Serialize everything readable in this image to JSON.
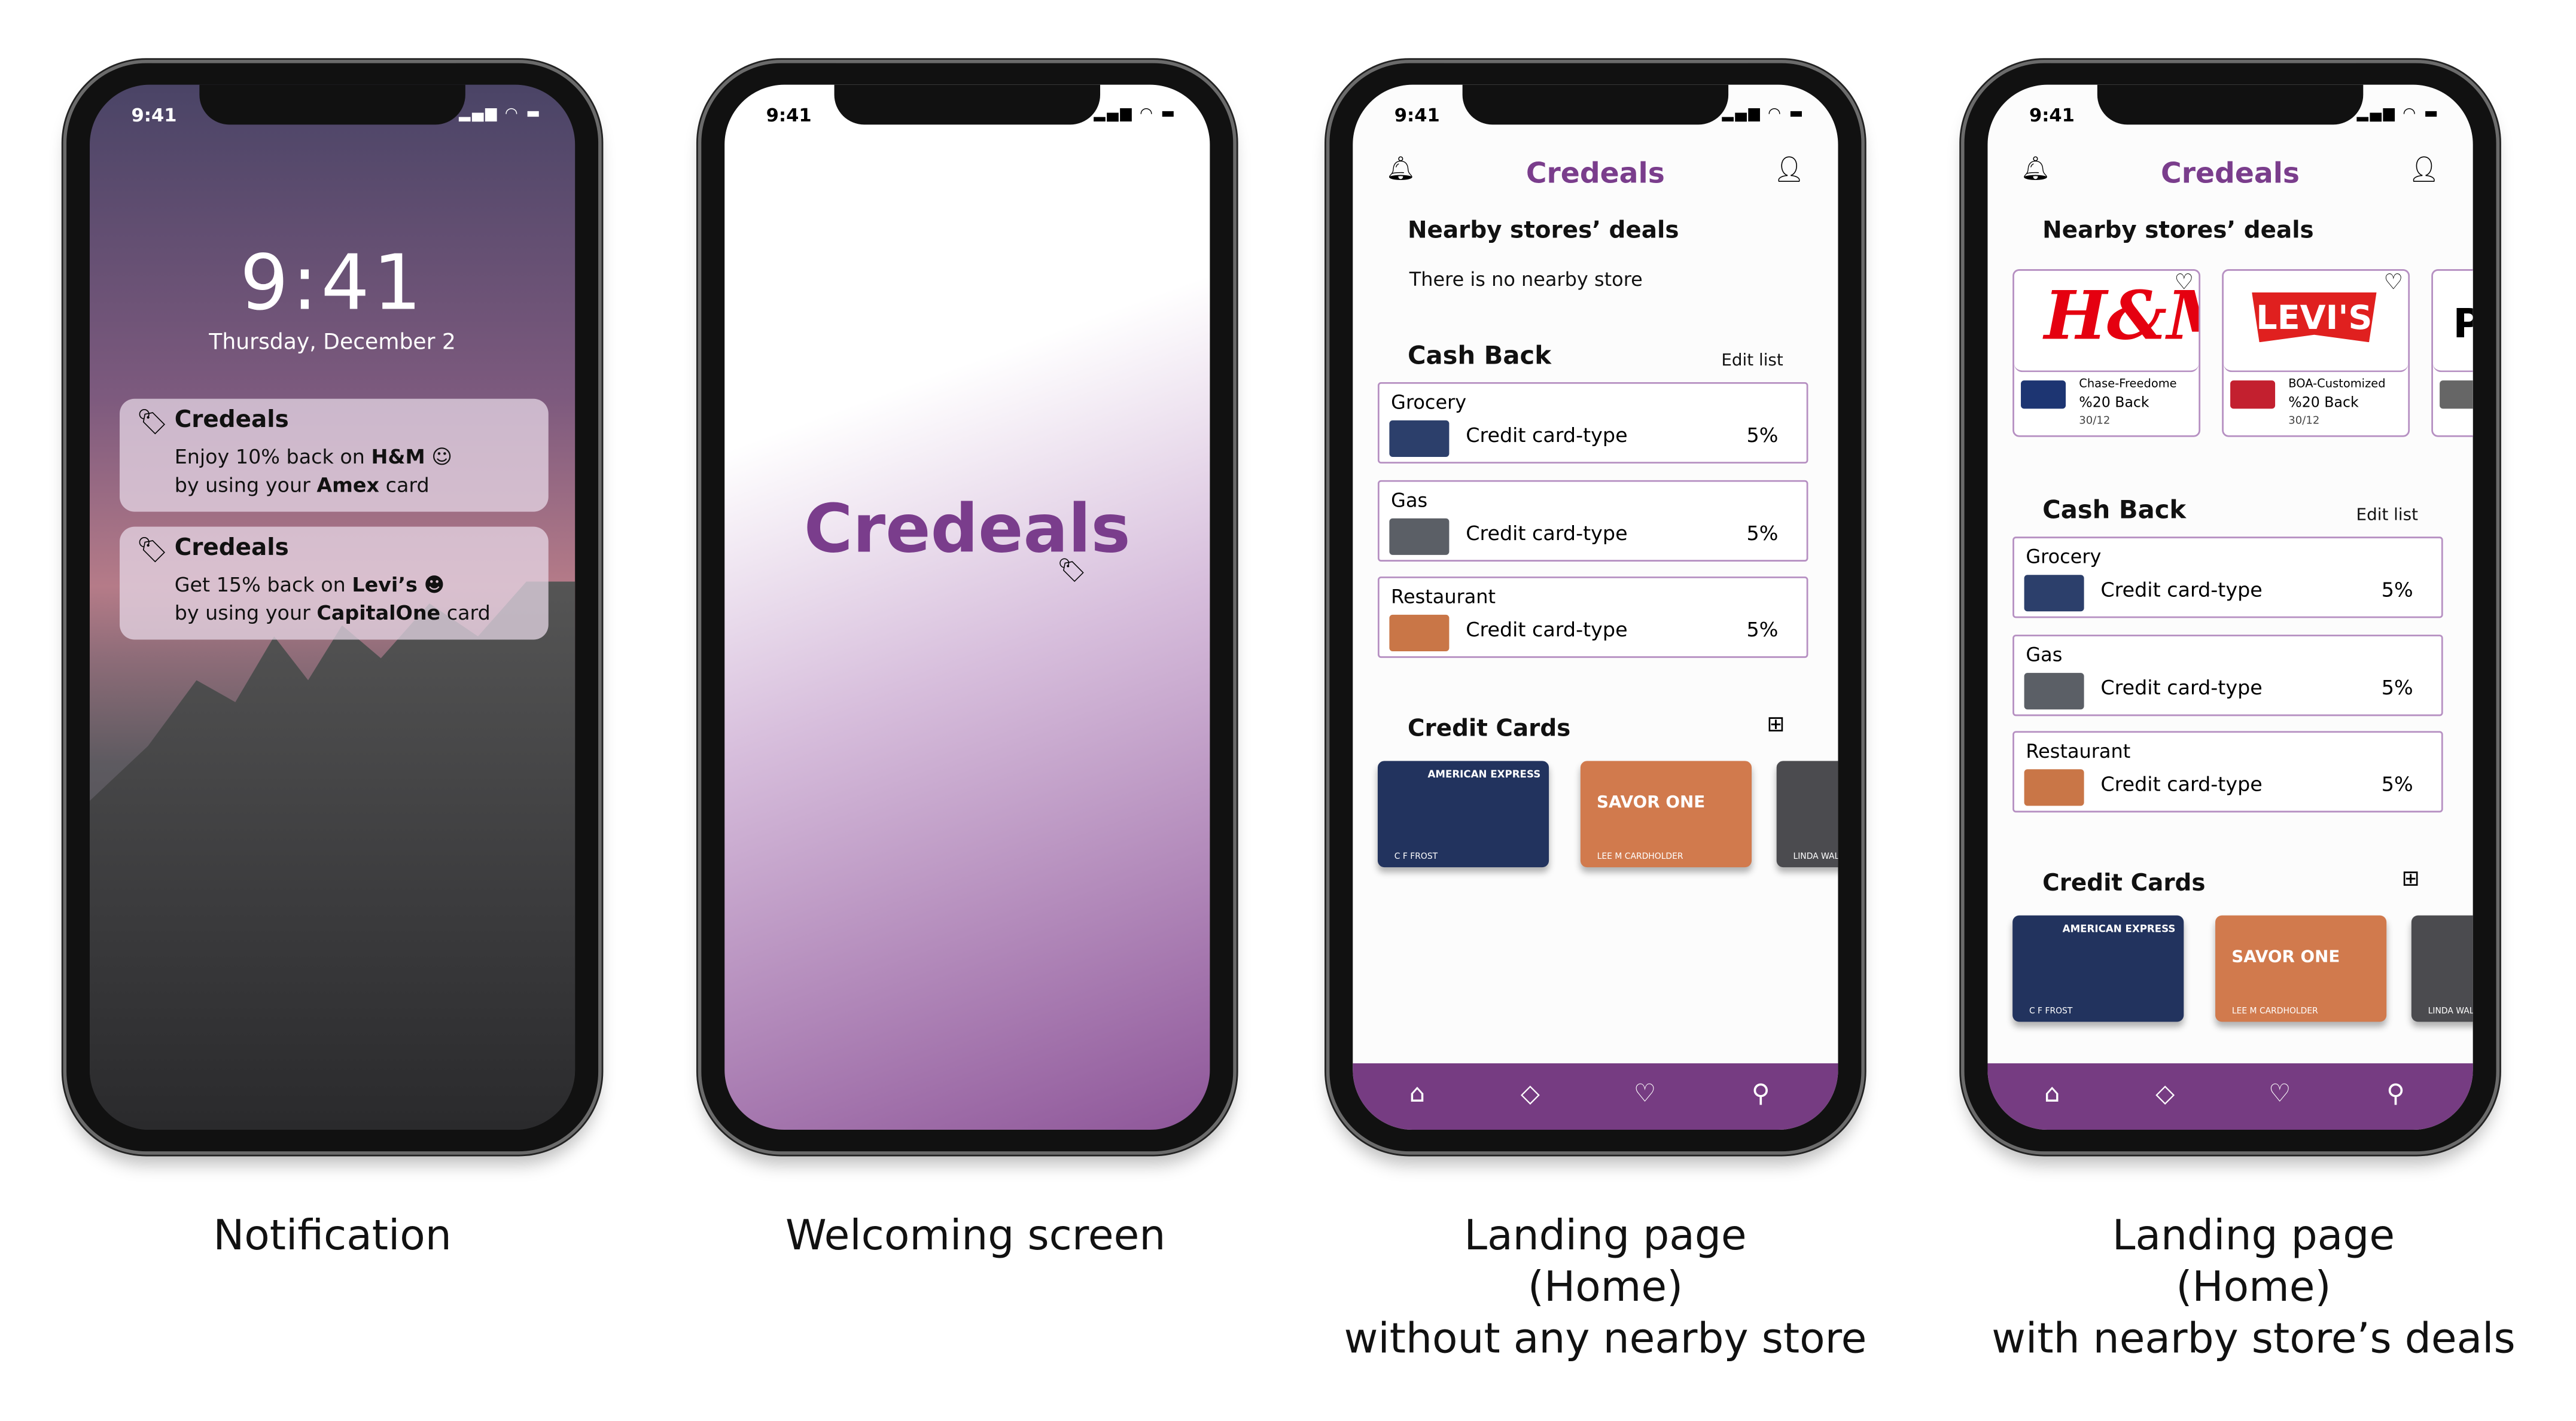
{
  "status_time": "9:41",
  "lock": {
    "time": "9:41",
    "date": "Thursday, December 2",
    "notifications": [
      {
        "app": "Credeals",
        "line1_pre": "Enjoy 10% back on ",
        "line1_bold": "H&M",
        "line2_pre": "by using your ",
        "line2_bold": "Amex",
        "line2_post": " card",
        "emoji": "☺"
      },
      {
        "app": "Credeals",
        "line1_pre": "Get 15% back on ",
        "line1_bold": "Levi’s",
        "line2_pre": "by using your ",
        "line2_bold": "CapitalOne",
        "line2_post": " card",
        "emoji": "☻"
      }
    ]
  },
  "welcome": {
    "logo": "Credeals"
  },
  "app": {
    "title": "Credeals",
    "nearby_heading": "Nearby stores’ deals",
    "no_nearby": "There is no nearby store",
    "cashback_heading": "Cash Back",
    "edit_list": "Edit list",
    "cards_heading": "Credit Cards",
    "cashback": [
      {
        "category": "Grocery",
        "card": "Credit card-type",
        "percent": "5%",
        "color": "#2c3f6b"
      },
      {
        "category": "Gas",
        "card": "Credit card-type",
        "percent": "5%",
        "color": "#5b5f66"
      },
      {
        "category": "Restaurant",
        "card": "Credit card-type",
        "percent": "5%",
        "color": "#c97647"
      }
    ],
    "cards": [
      {
        "brand": "AMERICAN EXPRESS",
        "holder": "C F FROST",
        "color": "#22335e"
      },
      {
        "brand": "SAVOR ONE",
        "holder": "LEE M CARDHOLDER",
        "color": "#d17a4d"
      },
      {
        "brand": "",
        "holder": "LINDA WALKER",
        "color": "#4b4b4f"
      }
    ],
    "deals": [
      {
        "store": "H&M",
        "card": "Chase-Freedome",
        "back": "%20 Back",
        "date": "30/12",
        "card_color": "#1d3572"
      },
      {
        "store": "LEVI'S",
        "card": "BOA-Customized",
        "back": "%20 Back",
        "date": "30/12",
        "card_color": "#c3202f"
      }
    ],
    "nav": [
      "home-icon",
      "tag-icon",
      "heart-icon",
      "search-icon"
    ],
    "accent": "#7a3d8c",
    "nav_color": "#763c82"
  },
  "captions": [
    "Notification",
    "Welcoming screen",
    "Landing page\n(Home)\nwithout any nearby store",
    "Landing page\n(Home)\nwith nearby store’s deals"
  ]
}
